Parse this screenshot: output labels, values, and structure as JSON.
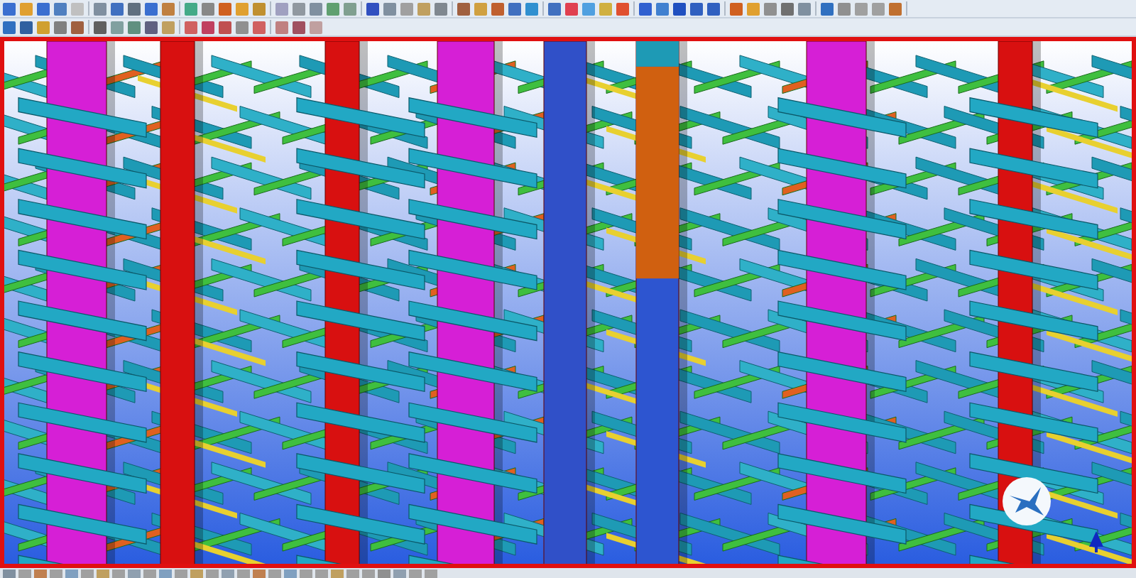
{
  "toolbars": [
    {
      "kind": "main"
    },
    {
      "kind": "modeling"
    }
  ],
  "viewport": {
    "selected": true
  },
  "status_bar": {
    "kind": "icons"
  }
}
